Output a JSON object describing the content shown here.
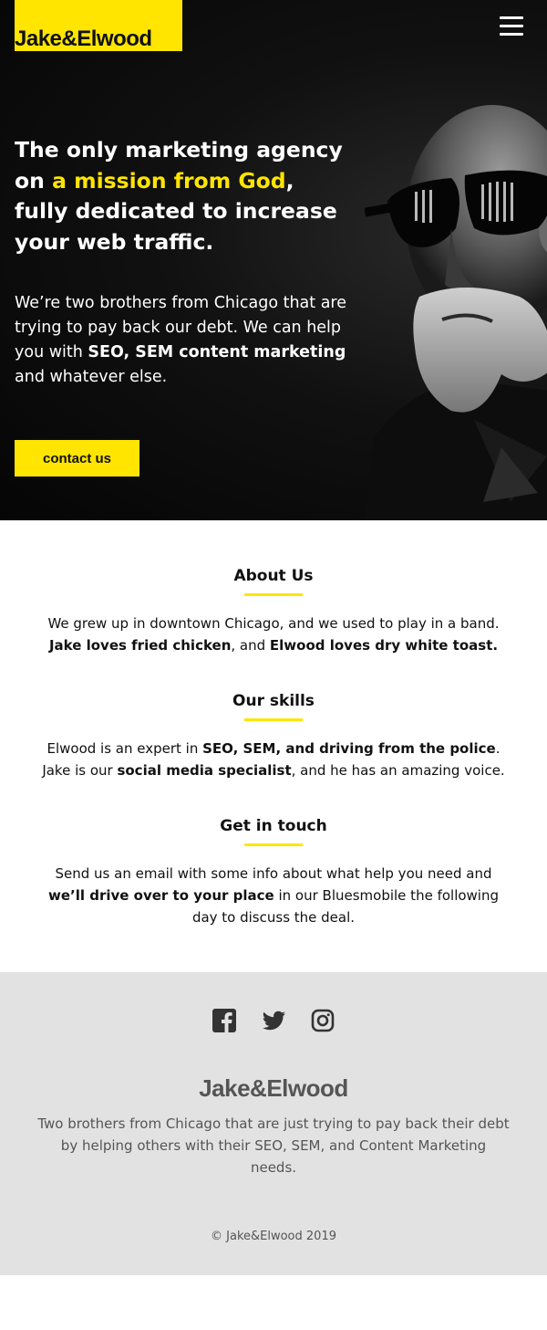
{
  "brand": {
    "name": "Jake&Elwood",
    "accent": "#ffe500"
  },
  "nav": {
    "menu_icon": "hamburger-menu-icon"
  },
  "hero": {
    "headline_before": "The only marketing agency on ",
    "headline_highlight": "a mission from God",
    "headline_after": ", fully dedicated to increase your web traffic.",
    "lead_before": "We’re two brothers from Chicago that are trying to pay back our debt. We can help you with ",
    "lead_bold": "SEO, SEM content marketing",
    "lead_after": " and whatever else.",
    "cta_label": "contact us"
  },
  "sections": [
    {
      "title": "About Us",
      "p1": "We grew up in downtown Chicago, and we used to play in a band. ",
      "b1": "Jake loves fried chicken",
      "p2": ", and ",
      "b2": "Elwood loves dry white toast.",
      "p3": ""
    },
    {
      "title": "Our skills",
      "p1": "Elwood is an expert in ",
      "b1": "SEO, SEM, and driving from the police",
      "p2": ". Jake is our ",
      "b2": "social media specialist",
      "p3": ", and he has an amazing voice."
    },
    {
      "title": "Get in touch",
      "p1": "Send us an email with some info about what help you need and ",
      "b1": "we’ll drive over to your place",
      "p2": " in our Bluesmobile the following day to discuss the deal.",
      "b2": "",
      "p3": ""
    }
  ],
  "footer": {
    "social": [
      "facebook-icon",
      "twitter-icon",
      "instagram-icon"
    ],
    "logo": "Jake&Elwood",
    "description": "Two brothers from Chicago that are just trying to pay back their debt by helping others with their SEO, SEM, and Content Marketing needs.",
    "copyright": "© Jake&Elwood 2019"
  }
}
